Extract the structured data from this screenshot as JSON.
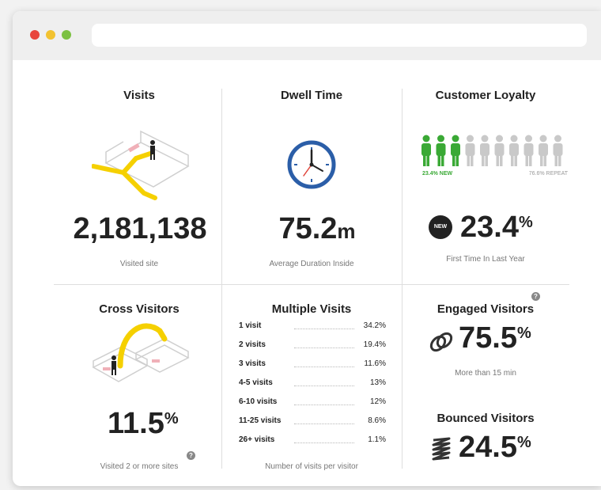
{
  "browser": {
    "buttons": [
      "close",
      "minimize",
      "maximize"
    ],
    "address_value": ""
  },
  "visits": {
    "title": "Visits",
    "value": "2,181,138",
    "caption": "Visited site"
  },
  "dwell_time": {
    "title": "Dwell Time",
    "value": "75.2",
    "unit": "m",
    "caption": "Average Duration Inside"
  },
  "customer_loyalty": {
    "title": "Customer Loyalty",
    "new_label": "23.4% NEW",
    "repeat_label": "76.6% REPEAT",
    "new_people": 3,
    "total_people": 10,
    "new_badge": "NEW",
    "value": "23.4",
    "percent": "%",
    "caption": "First Time In Last Year",
    "colors": {
      "new": "#3aa935",
      "repeat": "#c9c9c9"
    }
  },
  "cross_visitors": {
    "title": "Cross Visitors",
    "value": "11.5",
    "percent": "%",
    "caption": "Visited 2 or more sites",
    "info": "?"
  },
  "multiple_visits": {
    "title": "Multiple Visits",
    "rows": [
      {
        "label": "1 visit",
        "value": "34.2%"
      },
      {
        "label": "2 visits",
        "value": "19.4%"
      },
      {
        "label": "3 visits",
        "value": "11.6%"
      },
      {
        "label": "4-5 visits",
        "value": "13%"
      },
      {
        "label": "6-10 visits",
        "value": "12%"
      },
      {
        "label": "11-25 visits",
        "value": "8.6%"
      },
      {
        "label": "26+ visits",
        "value": "1.1%"
      }
    ],
    "caption": "Number of visits per visitor"
  },
  "engaged_visitors": {
    "title": "Engaged Visitors",
    "value": "75.5",
    "percent": "%",
    "caption": "More than 15 min",
    "info": "?",
    "icon": "link-icon"
  },
  "bounced_visitors": {
    "title": "Bounced Visitors",
    "value": "24.5",
    "percent": "%",
    "icon": "spring-icon"
  },
  "colors": {
    "accent_yellow": "#f5d000",
    "clock_blue": "#2b5ea8",
    "clock_red": "#e0443a"
  }
}
